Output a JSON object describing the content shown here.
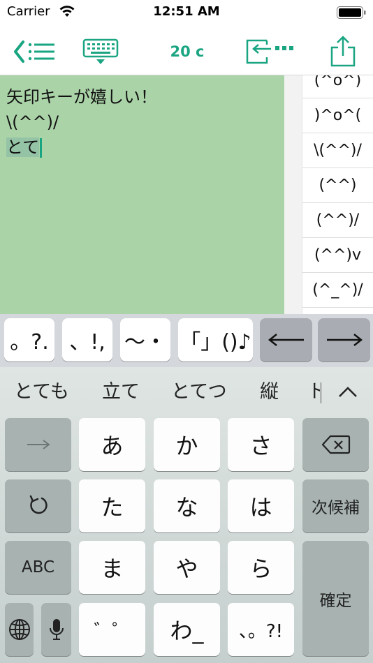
{
  "status_bar": {
    "carrier": "Carrier",
    "time": "12:51 AM"
  },
  "toolbar": {
    "char_count": "20 c",
    "accent_color": "#1aa582"
  },
  "editor": {
    "lines": [
      "矢印キーが嬉しい！",
      "\\(^^)/",
      "とて"
    ],
    "background": "#aad4a8"
  },
  "emoticons": [
    "(^o^)",
    ")^o^(",
    "\\(^^)/",
    "(^^)",
    "(^^)/",
    "(^^)v",
    "(^_^)/",
    "(^^;)"
  ],
  "accessory_keys": [
    "。?.",
    "、!,",
    "〜・",
    "「」()♪",
    "←",
    "→"
  ],
  "candidates": [
    "とても",
    "立て",
    "とてつ",
    "縦",
    "ト"
  ],
  "keyboard": {
    "row1": [
      "→",
      "あ",
      "か",
      "さ"
    ],
    "row2": [
      "た",
      "な",
      "は",
      "次候補"
    ],
    "row3": [
      "ABC",
      "ま",
      "や",
      "ら",
      "確定"
    ],
    "row4": [
      "゛゜",
      "わ_",
      "、。?!"
    ]
  }
}
